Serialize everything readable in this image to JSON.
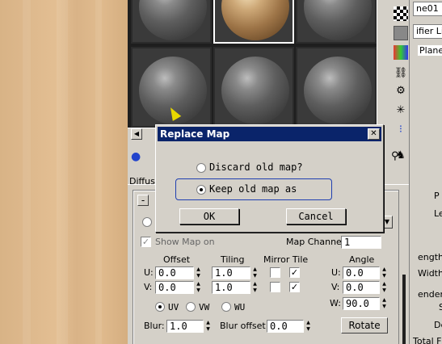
{
  "right_panel": {
    "name_field": "ne01",
    "modifier_list": "ifier Li",
    "stack_item": "Plane",
    "rollout_header": "P",
    "params": [
      "Le",
      "ength",
      "Width",
      "ender",
      "S",
      "De",
      "Total F"
    ]
  },
  "material_editor": {
    "map_label": "Diffuse",
    "show_map_label": "Show Map on",
    "map_channel_label": "Map Channel:",
    "map_channel_value": "1",
    "headers": {
      "offset": "Offset",
      "tiling": "Tiling",
      "mirror_tile": "Mirror Tile",
      "angle": "Angle"
    },
    "u_label": "U:",
    "v_label": "V:",
    "w_label": "W:",
    "offset_u": "0.0",
    "offset_v": "0.0",
    "tiling_u": "1.0",
    "tiling_v": "1.0",
    "angle_u": "0.0",
    "angle_v": "0.0",
    "angle_w": "90.0",
    "uv_modes": [
      "UV",
      "VW",
      "WU"
    ],
    "blur_label": "Blur:",
    "blur_value": "1.0",
    "blur_offset_label": "Blur offset:",
    "blur_offset_value": "0.0",
    "rotate_label": "Rotate",
    "collapse_label": "-"
  },
  "dialog": {
    "title": "Replace Map",
    "close": "✕",
    "option_discard": "Discard old map?",
    "option_keep": "Keep old map as",
    "ok": "OK",
    "cancel": "Cancel"
  },
  "colors": {
    "title_bar": "#0a246a",
    "face": "#d4d0c8",
    "focus": "#1f3fb0"
  }
}
